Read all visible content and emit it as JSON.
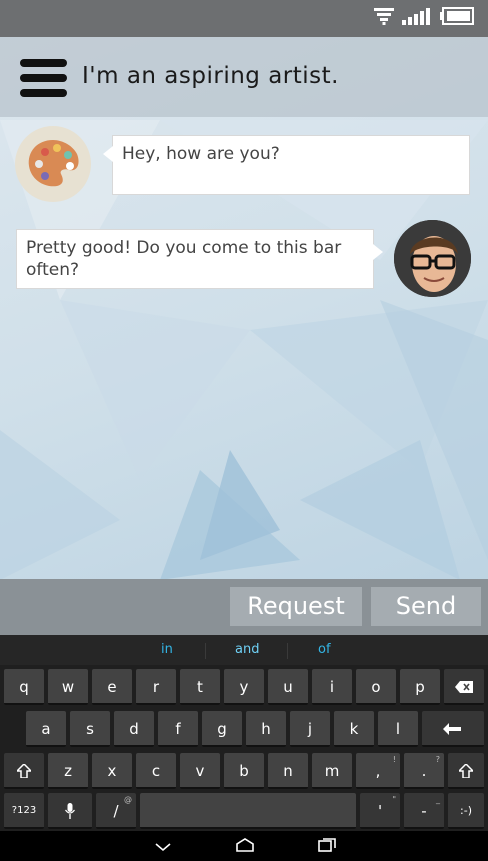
{
  "header": {
    "title": "I'm an aspiring artist."
  },
  "chat": {
    "messages": [
      {
        "sender": "other",
        "text": "Hey, how are you?"
      },
      {
        "sender": "me",
        "text": "Pretty good! Do you come to this bar often?"
      }
    ]
  },
  "actions": {
    "request_label": "Request",
    "send_label": "Send"
  },
  "keyboard": {
    "suggestions": [
      "in",
      "and",
      "of"
    ],
    "row1": [
      "q",
      "w",
      "e",
      "r",
      "t",
      "y",
      "u",
      "i",
      "o",
      "p"
    ],
    "row2": [
      "a",
      "s",
      "d",
      "f",
      "g",
      "h",
      "j",
      "k",
      "l"
    ],
    "row3": [
      "z",
      "x",
      "c",
      "v",
      "b",
      "n",
      "m",
      ",",
      "."
    ],
    "symbols_label": "?123",
    "slash_label": "/",
    "apostrophe_label": "'",
    "dash_label": "-",
    "smiley_label": ":-)",
    "sub_labels": {
      "slash": "@",
      "comma": "!",
      "period": "?",
      "apostrophe": "\"",
      "dash": "_"
    }
  },
  "colors": {
    "status_bar": "#6d6f71",
    "action_button": "#a5acb1",
    "suggestion_accent": "#33b5e5",
    "keyboard_bg": "#1f1f1f"
  },
  "icons": {
    "status": [
      "wifi-icon",
      "signal-icon",
      "battery-icon"
    ],
    "navigation": [
      "back-icon",
      "home-icon",
      "recent-apps-icon"
    ]
  }
}
